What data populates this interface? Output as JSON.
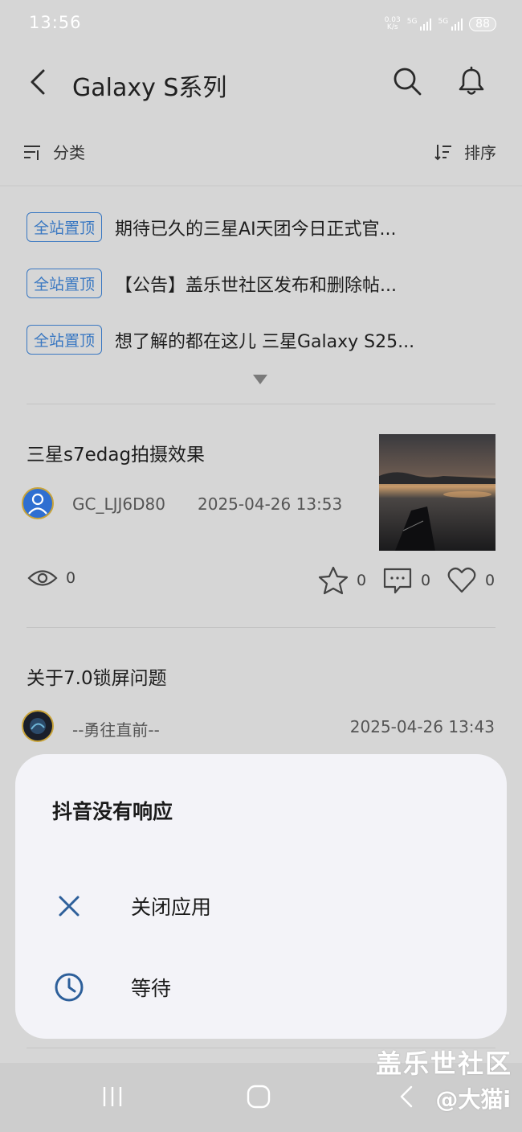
{
  "status_bar": {
    "time": "13:56",
    "net_speed": "0.03\nK/s",
    "sig1_label": "5G",
    "sig2_label": "5G",
    "battery": "88"
  },
  "header": {
    "title": "Galaxy S系列",
    "back_icon": "chevron-left-icon",
    "search_icon": "search-icon",
    "bell_icon": "bell-icon"
  },
  "filter_bar": {
    "category_label": "分类",
    "sort_label": "排序"
  },
  "pinned": [
    {
      "badge": "全站置顶",
      "text": "期待已久的三星AI天团今日正式官..."
    },
    {
      "badge": "全站置顶",
      "text": "【公告】盖乐世社区发布和删除帖..."
    },
    {
      "badge": "全站置顶",
      "text": "想了解的都在这儿 三星Galaxy S25..."
    }
  ],
  "posts": [
    {
      "title": "三星s7edag拍摄效果",
      "author": "GC_LJJ6D80",
      "time": "2025-04-26 13:53",
      "views": "0",
      "favorites": "0",
      "comments": "0",
      "likes": "0"
    },
    {
      "title": "关于7.0锁屏问题",
      "author": "--勇往直前--",
      "time": "2025-04-26 13:43"
    }
  ],
  "dialog": {
    "title": "抖音没有响应",
    "close_label": "关闭应用",
    "wait_label": "等待"
  },
  "watermark": {
    "line1": "盖乐世社区",
    "line2": "@大猫i"
  },
  "colors": {
    "badge_blue": "#3a78c2",
    "dialog_icon_blue": "#2d5f9a",
    "background": "#d6d6d6",
    "dialog_bg": "#f3f3f8"
  }
}
